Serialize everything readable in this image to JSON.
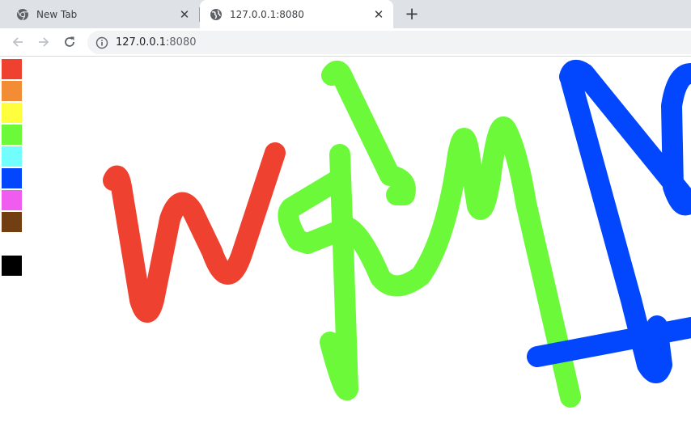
{
  "browser": {
    "tabs": [
      {
        "title": "New Tab",
        "icon": "chrome-icon",
        "active": false
      },
      {
        "title": "127.0.0.1:8080",
        "icon": "globe-icon",
        "active": true
      }
    ],
    "new_tab_icon": "plus-icon",
    "address": {
      "host": "127.0.0.1",
      "port": ":8080",
      "icon": "info-icon"
    },
    "nav_icons": [
      "back-arrow-icon",
      "forward-arrow-icon",
      "reload-icon"
    ]
  },
  "palette": {
    "colors": [
      "#ee4130",
      "#f28c35",
      "#fefe3d",
      "#6bf93a",
      "#72fdfe",
      "#0246fd",
      "#f05cf0",
      "#713f12",
      "#ffffff",
      "#000000"
    ]
  },
  "drawing": {
    "strokes": [
      {
        "color": "#ee4130",
        "description": "red scribble"
      },
      {
        "color": "#6bf93a",
        "description": "green scribble"
      },
      {
        "color": "#0246fd",
        "description": "blue scribble"
      }
    ]
  }
}
